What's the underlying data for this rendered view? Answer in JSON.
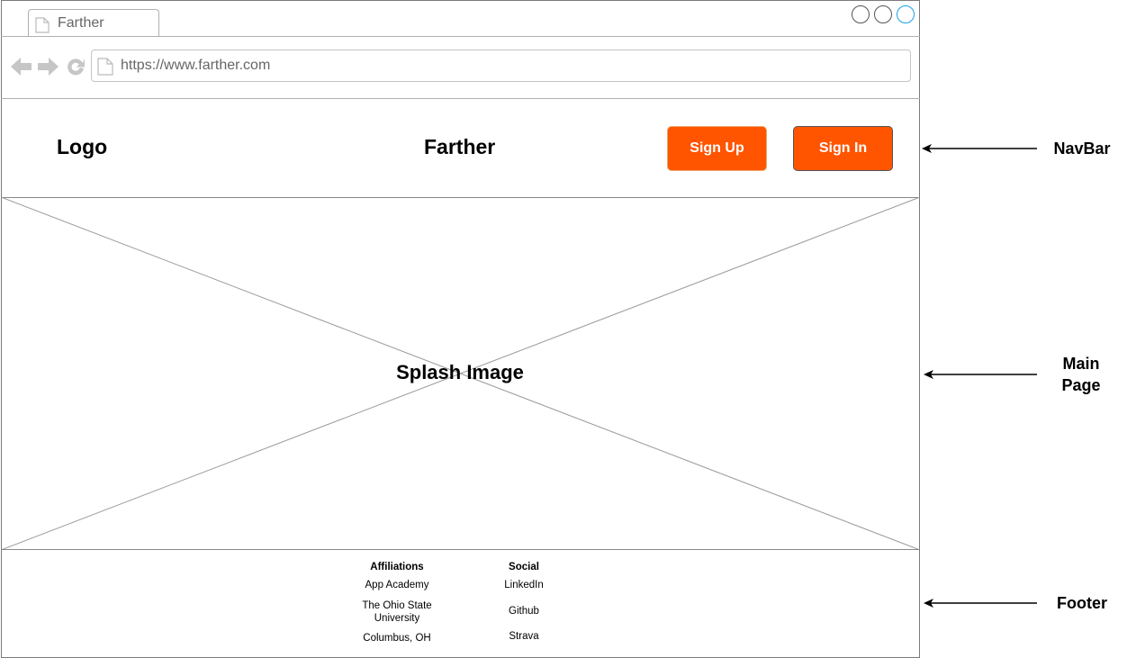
{
  "browser": {
    "tab_title": "Farther",
    "url": "https://www.farther.com"
  },
  "navbar": {
    "logo": "Logo",
    "title": "Farther",
    "sign_up_label": "Sign Up",
    "sign_in_label": "Sign In",
    "button_color": "#ff5400"
  },
  "main": {
    "splash_label": "Splash Image"
  },
  "footer": {
    "affiliations": {
      "heading": "Affiliations",
      "items": [
        "App Academy",
        "The Ohio State University",
        "Columbus, OH"
      ]
    },
    "social": {
      "heading": "Social",
      "items": [
        "LinkedIn",
        "Github",
        "Strava"
      ]
    }
  },
  "annotations": {
    "navbar": "NavBar",
    "main_line1": "Main",
    "main_line2": "Page",
    "footer": "Footer"
  }
}
